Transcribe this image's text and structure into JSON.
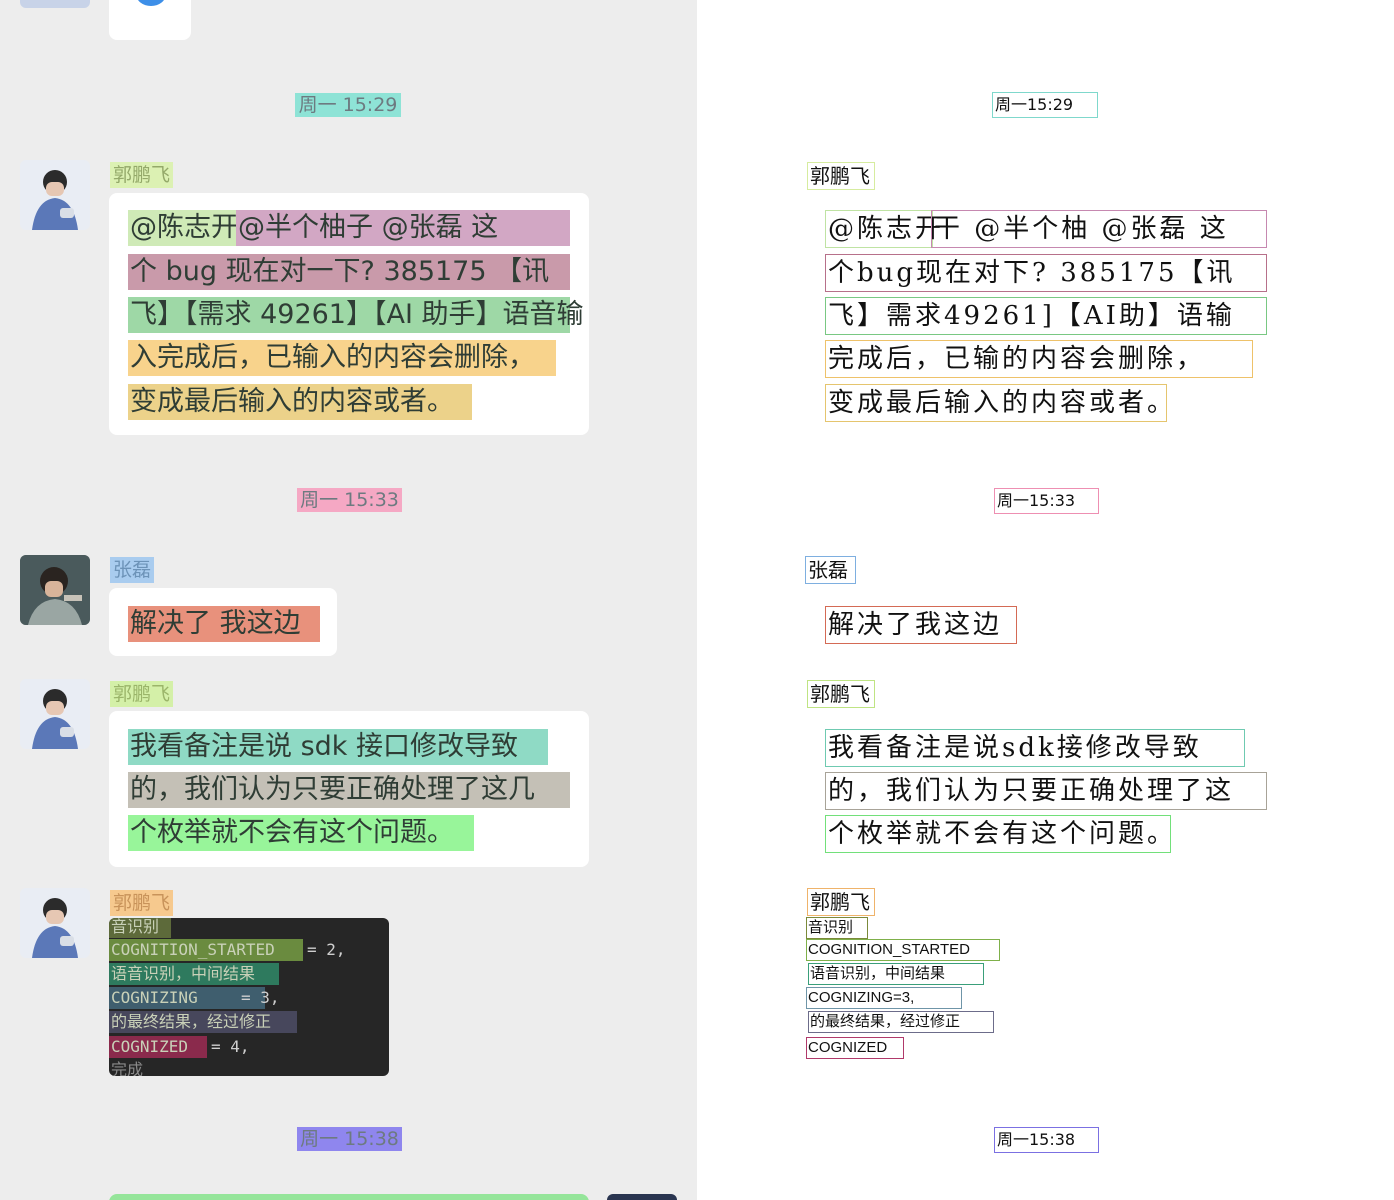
{
  "timestamps": [
    "周一 15:29",
    "周一 15:33",
    "周一 15:38"
  ],
  "messages": [
    {
      "sender": "郭鹏飞",
      "lines": [
        "@陈志开",
        "@半个柚子 @张磊 这",
        "个 bug 现在对一下? 385175 【讯",
        "飞】【需求 49261】【AI 助手】语音输",
        "入完成后，已输入的内容会删除，",
        "变成最后输入的内容或者。"
      ]
    },
    {
      "sender": "张磊",
      "lines": [
        "解决了 我这边"
      ]
    },
    {
      "sender": "郭鹏飞",
      "lines": [
        "我看备注是说 sdk 接口修改导致",
        "的，我们认为只要正确处理了这几",
        "个枚举就不会有这个问题。"
      ]
    },
    {
      "sender": "郭鹏飞",
      "code": {
        "lines": [
          "音识别",
          "COGNITION_STARTED",
          "语音识别，中间结果",
          "COGNIZING",
          "的最终结果，经过修正",
          "COGNIZED",
          "完成"
        ],
        "values": [
          "= 2,",
          "= 3,",
          "= 4,"
        ]
      }
    }
  ],
  "ocr": {
    "timestamps": [
      "周一15:29",
      "周一15:33",
      "周一15:38"
    ],
    "senders": [
      "郭鹏飞",
      "张磊",
      "郭鹏飞",
      "郭鹏飞"
    ],
    "msg1": [
      "@陈志开",
      "干 @半个柚 @张磊 这",
      "个bug现在对下? 385175【讯",
      "飞】需求49261]【AI助】语输",
      "完成后，已输的内容会删除，",
      "变成最后输入的内容或者。"
    ],
    "msg2": [
      "解决了我这边"
    ],
    "msg3": [
      "我看备注是说sdk接修改导致",
      "的，我们认为只要正确处理了这",
      "个枚举就不会有这个问题。"
    ],
    "code": [
      "音识别",
      "COGNITION_STARTED",
      "语音识别，中间结果",
      "COGNIZING=3,",
      "的最终结果，经过修正",
      "COGNIZED"
    ]
  }
}
